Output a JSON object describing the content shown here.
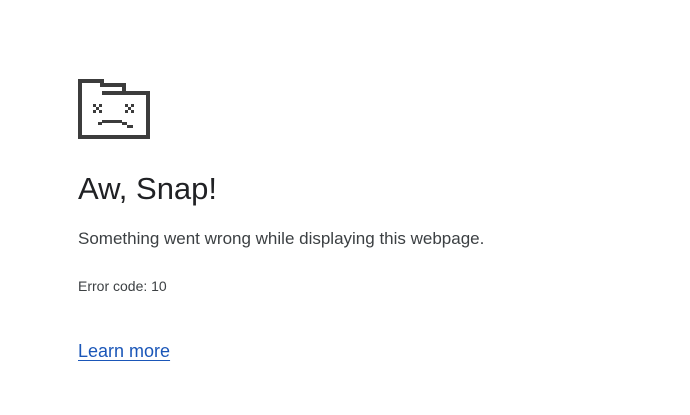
{
  "error_page": {
    "icon": "sad-tab-icon",
    "title": "Aw, Snap!",
    "message": "Something went wrong while displaying this webpage.",
    "error_code": "Error code: 10",
    "learn_more_label": "Learn more",
    "colors": {
      "text": "#202124",
      "secondary_text": "#3c4043",
      "link": "#1a56b8",
      "icon": "#3c3c3c"
    }
  }
}
